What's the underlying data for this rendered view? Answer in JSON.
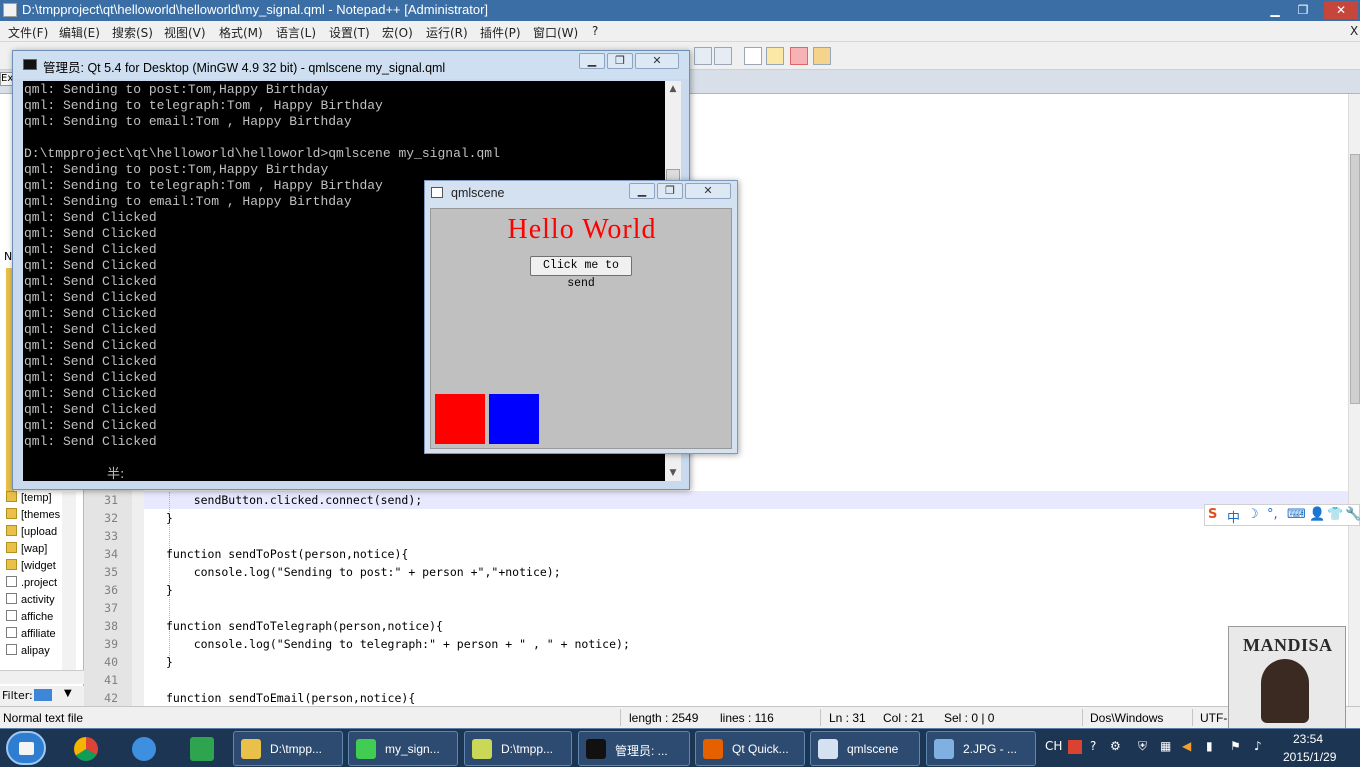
{
  "npp": {
    "title": "D:\\tmpproject\\qt\\helloworld\\helloworld\\my_signal.qml - Notepad++ [Administrator]",
    "menu": [
      "文件(F)",
      "编辑(E)",
      "搜索(S)",
      "视图(V)",
      "格式(M)",
      "语言(L)",
      "设置(T)",
      "宏(O)",
      "运行(R)",
      "插件(P)",
      "窗口(W)",
      "?"
    ],
    "close_x": "X"
  },
  "file_panel": {
    "items": [
      {
        "label": "[temp]",
        "type": "folder"
      },
      {
        "label": "[themes",
        "type": "folder"
      },
      {
        "label": "[upload",
        "type": "folder"
      },
      {
        "label": "[wap]",
        "type": "folder"
      },
      {
        "label": "[widget",
        "type": "folder"
      },
      {
        "label": ".project",
        "type": "file"
      },
      {
        "label": "activity",
        "type": "file"
      },
      {
        "label": "affiche",
        "type": "file"
      },
      {
        "label": "affiliate",
        "type": "file"
      },
      {
        "label": "alipay",
        "type": "file"
      }
    ],
    "filter_label": "Filter:",
    "stub_ex": "Ex",
    "stub_n": "N"
  },
  "editor": {
    "lines": [
      {
        "n": "31",
        "code": "    sendButton.clicked.connect(send);"
      },
      {
        "n": "32",
        "code": "}"
      },
      {
        "n": "33",
        "code": ""
      },
      {
        "n": "34",
        "code": "function sendToPost(person,notice){"
      },
      {
        "n": "35",
        "code": "    console.log(\"Sending to post:\" + person +\",\"+notice);"
      },
      {
        "n": "36",
        "code": "}"
      },
      {
        "n": "37",
        "code": ""
      },
      {
        "n": "38",
        "code": "function sendToTelegraph(person,notice){"
      },
      {
        "n": "39",
        "code": "    console.log(\"Sending to telegraph:\" + person + \" , \" + notice);"
      },
      {
        "n": "40",
        "code": "}"
      },
      {
        "n": "41",
        "code": ""
      },
      {
        "n": "42",
        "code": "function sendToEmail(person,notice){"
      }
    ]
  },
  "status": {
    "type": "Normal text file",
    "length": "length : 2549",
    "lines": "lines : 116",
    "ln": "Ln : 31",
    "col": "Col : 21",
    "sel": "Sel : 0 | 0",
    "eol": "Dos\\Windows",
    "encoding": "UTF-"
  },
  "console": {
    "title": "管理员: Qt 5.4 for Desktop (MinGW 4.9 32 bit) - qmlscene  my_signal.qml",
    "lines": [
      "qml: Sending to post:Tom,Happy Birthday",
      "qml: Sending to telegraph:Tom , Happy Birthday",
      "qml: Sending to email:Tom , Happy Birthday",
      "",
      "D:\\tmpproject\\qt\\helloworld\\helloworld>qmlscene my_signal.qml",
      "qml: Sending to post:Tom,Happy Birthday",
      "qml: Sending to telegraph:Tom , Happy Birthday",
      "qml: Sending to email:Tom , Happy Birthday",
      "qml: Send Clicked",
      "qml: Send Clicked",
      "qml: Send Clicked",
      "qml: Send Clicked",
      "qml: Send Clicked",
      "qml: Send Clicked",
      "qml: Send Clicked",
      "qml: Send Clicked",
      "qml: Send Clicked",
      "qml: Send Clicked",
      "qml: Send Clicked",
      "qml: Send Clicked",
      "qml: Send Clicked",
      "qml: Send Clicked",
      "qml: Send Clicked"
    ],
    "ime_indicator": "半:"
  },
  "qmlscene": {
    "title": "qmlscene",
    "hello": "Hello World",
    "button": "Click me to send",
    "colors": {
      "red": "#ff0000",
      "blue": "#0000ff",
      "bg": "#c0c0c0"
    }
  },
  "ime": {
    "items": [
      "S",
      "中",
      "☽",
      "°,",
      "⌨",
      "👤",
      "👕",
      "🔧"
    ]
  },
  "album": {
    "artist": "MANDISA"
  },
  "taskbar": {
    "tasks": [
      {
        "label": "D:\\tmpp...",
        "icon": "folder-icon"
      },
      {
        "label": "my_sign...",
        "icon": "qt-icon"
      },
      {
        "label": "D:\\tmpp...",
        "icon": "notepadpp-icon"
      },
      {
        "label": "管理员: ...",
        "icon": "console-icon"
      },
      {
        "label": "Qt Quick...",
        "icon": "firefox-icon"
      },
      {
        "label": "qmlscene",
        "icon": "qml-window-icon"
      },
      {
        "label": "2.JPG - ...",
        "icon": "image-viewer-icon"
      }
    ],
    "tray_lang": "CH",
    "time": "23:54",
    "date": "2015/1/29"
  }
}
